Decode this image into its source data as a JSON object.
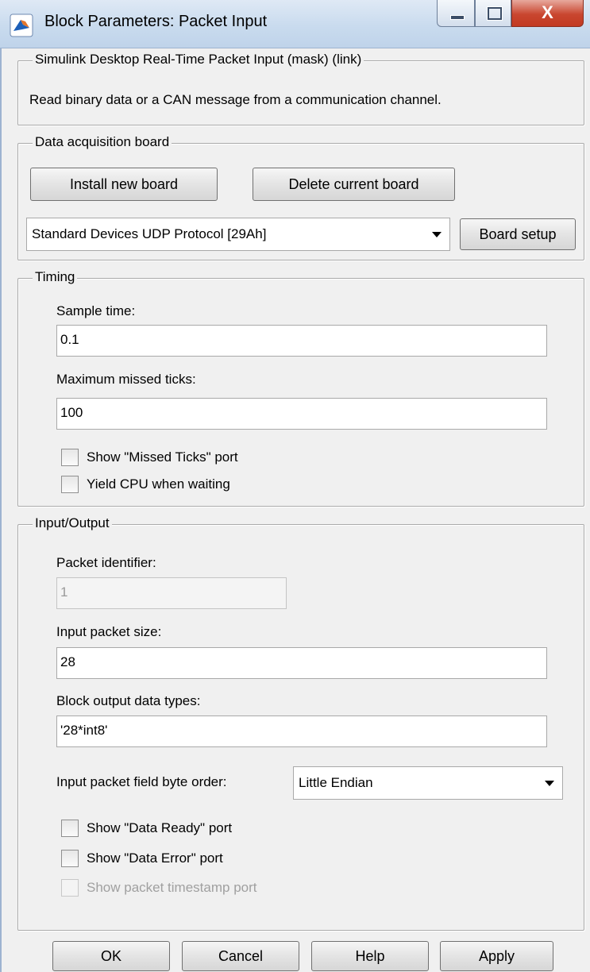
{
  "window": {
    "title": "Block Parameters: Packet Input",
    "controls": {
      "minimize": "minimize",
      "maximize": "maximize",
      "close_glyph": "X"
    },
    "app_icon": "matlab-icon"
  },
  "mask": {
    "legend": "Simulink Desktop Real-Time Packet Input (mask) (link)",
    "description": "Read binary data or a CAN message from a communication channel."
  },
  "board": {
    "legend": "Data acquisition board",
    "install_label": "Install new board",
    "delete_label": "Delete current board",
    "selected": "Standard Devices UDP Protocol [29Ah]",
    "setup_label": "Board setup"
  },
  "timing": {
    "legend": "Timing",
    "sample_time_label": "Sample time:",
    "sample_time": "0.1",
    "max_missed_label": "Maximum missed ticks:",
    "max_missed": "100",
    "show_missed_label": "Show \"Missed Ticks\" port",
    "show_missed_checked": false,
    "yield_cpu_label": "Yield CPU when waiting",
    "yield_cpu_checked": false
  },
  "io": {
    "legend": "Input/Output",
    "packet_id_label": "Packet identifier:",
    "packet_id": "1",
    "packet_size_label": "Input packet size:",
    "packet_size": "28",
    "output_types_label": "Block output data types:",
    "output_types": "'28*int8'",
    "byte_order_label": "Input packet field byte order:",
    "byte_order": "Little Endian",
    "data_ready_label": "Show \"Data Ready\" port",
    "data_error_label": "Show \"Data Error\" port",
    "timestamp_label": "Show packet timestamp port"
  },
  "buttons": {
    "ok": "OK",
    "cancel": "Cancel",
    "help": "Help",
    "apply": "Apply"
  }
}
